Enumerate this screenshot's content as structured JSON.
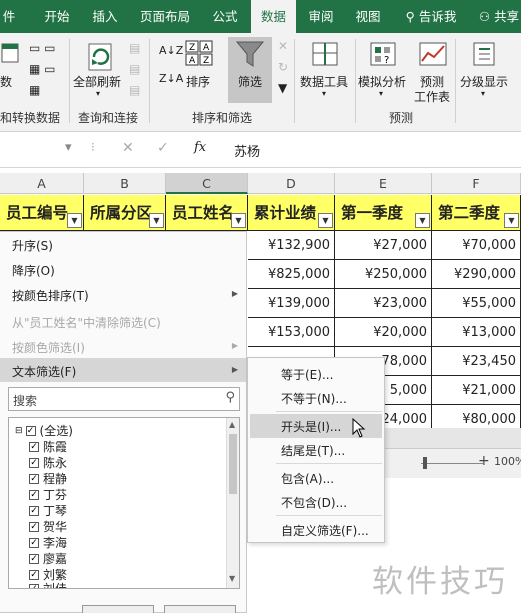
{
  "ribbon_tabs": [
    "件",
    "开始",
    "插入",
    "页面布局",
    "公式",
    "数据",
    "审阅",
    "视图",
    "告诉我",
    "共享"
  ],
  "ribbon": {
    "cut_labels": [
      "数",
      "和转换数据"
    ],
    "refresh_all": "全部刷新",
    "query_group": "查询和连接",
    "sort": "排序",
    "filter": "筛选",
    "sort_filter_group": "排序和筛选",
    "data_tools": "数据工具",
    "what_if": "模拟分析",
    "forecast_sheet_line1": "预测",
    "forecast_sheet_line2": "工作表",
    "forecast_group": "预测",
    "outline": "分级显示"
  },
  "formula_bar": {
    "fx": "fx",
    "value": "苏杨"
  },
  "columns": [
    "A",
    "B",
    "C",
    "D",
    "E",
    "F"
  ],
  "headers": [
    "员工编号",
    "所属分区",
    "员工姓名",
    "累计业绩",
    "第一季度",
    "第二季度"
  ],
  "rows": [
    [
      "¥132,900",
      "¥27,000",
      "¥70,000"
    ],
    [
      "¥825,000",
      "¥250,000",
      "¥290,000"
    ],
    [
      "¥139,000",
      "¥23,000",
      "¥55,000"
    ],
    [
      "¥153,000",
      "¥20,000",
      "¥13,000"
    ],
    [
      "",
      "78,000",
      "¥23,450"
    ],
    [
      "",
      "5,000",
      "¥21,000"
    ],
    [
      "",
      "24,000",
      "¥80,000"
    ]
  ],
  "filter_menu": {
    "sort_asc": "升序(S)",
    "sort_desc": "降序(O)",
    "sort_color": "按颜色排序(T)",
    "clear_filter": "从\"员工姓名\"中清除筛选(C)",
    "filter_color": "按颜色筛选(I)",
    "text_filter": "文本筛选(F)",
    "search_placeholder": "搜索",
    "select_all": "(全选)",
    "names": [
      "陈霞",
      "陈永",
      "程静",
      "丁芬",
      "丁琴",
      "贺华",
      "李海",
      "廖嘉",
      "刘繁",
      "刘佳"
    ]
  },
  "text_filter_submenu": {
    "equals": "等于(E)...",
    "not_equals": "不等于(N)...",
    "begins_with": "开头是(I)...",
    "ends_with": "结尾是(T)...",
    "contains": "包含(A)...",
    "not_contains": "不包含(D)...",
    "custom": "自定义筛选(F)..."
  },
  "status_bar": {
    "zoom": "100%"
  },
  "watermark": "软件技巧"
}
